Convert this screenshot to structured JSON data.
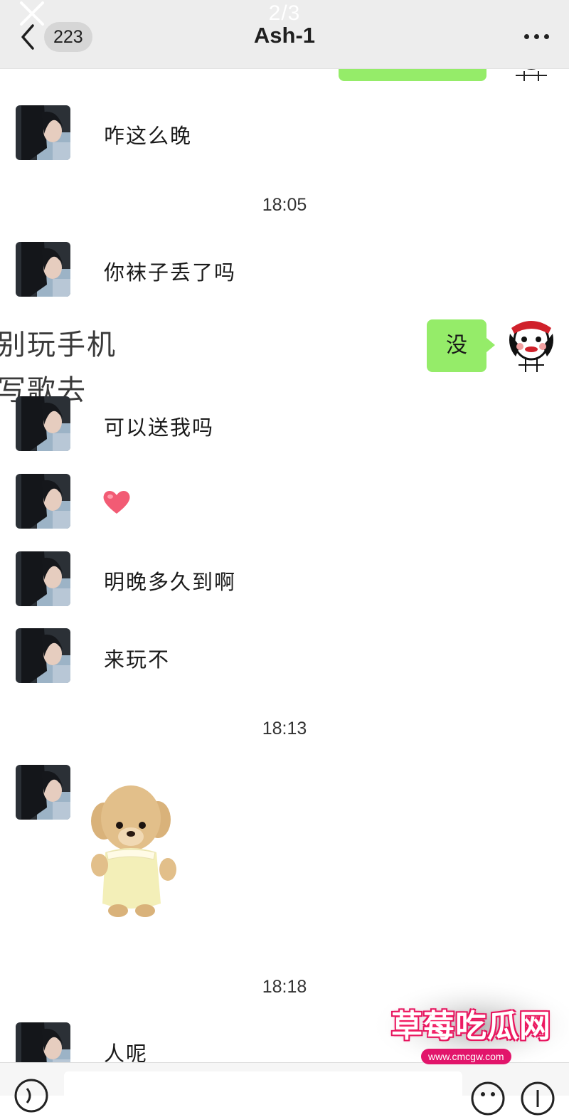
{
  "viewer": {
    "page_indicator": "2/3"
  },
  "header": {
    "unread_count": "223",
    "title": "Ash-1"
  },
  "messages": [
    {
      "text": "咋这么晚"
    },
    {
      "time": "18:05"
    },
    {
      "text": "你袜子丢了吗"
    },
    {
      "me_text": "没"
    },
    {
      "text": "可以送我吗"
    },
    {
      "emoji": "heart"
    },
    {
      "text": "明晚多久到啊"
    },
    {
      "text": "来玩不"
    },
    {
      "time": "18:13"
    },
    {
      "sticker": "plush-puppy"
    },
    {
      "time": "18:18"
    },
    {
      "text": "人呢"
    }
  ],
  "overlay_lines": [
    "别玩手机",
    "写歌去"
  ],
  "watermark": {
    "brand": "草莓吃瓜网",
    "url": "www.cmcgw.com"
  },
  "colors": {
    "bubble_green": "#95ec69",
    "header_bg": "#ededed",
    "accent_pink": "#e2156b"
  }
}
